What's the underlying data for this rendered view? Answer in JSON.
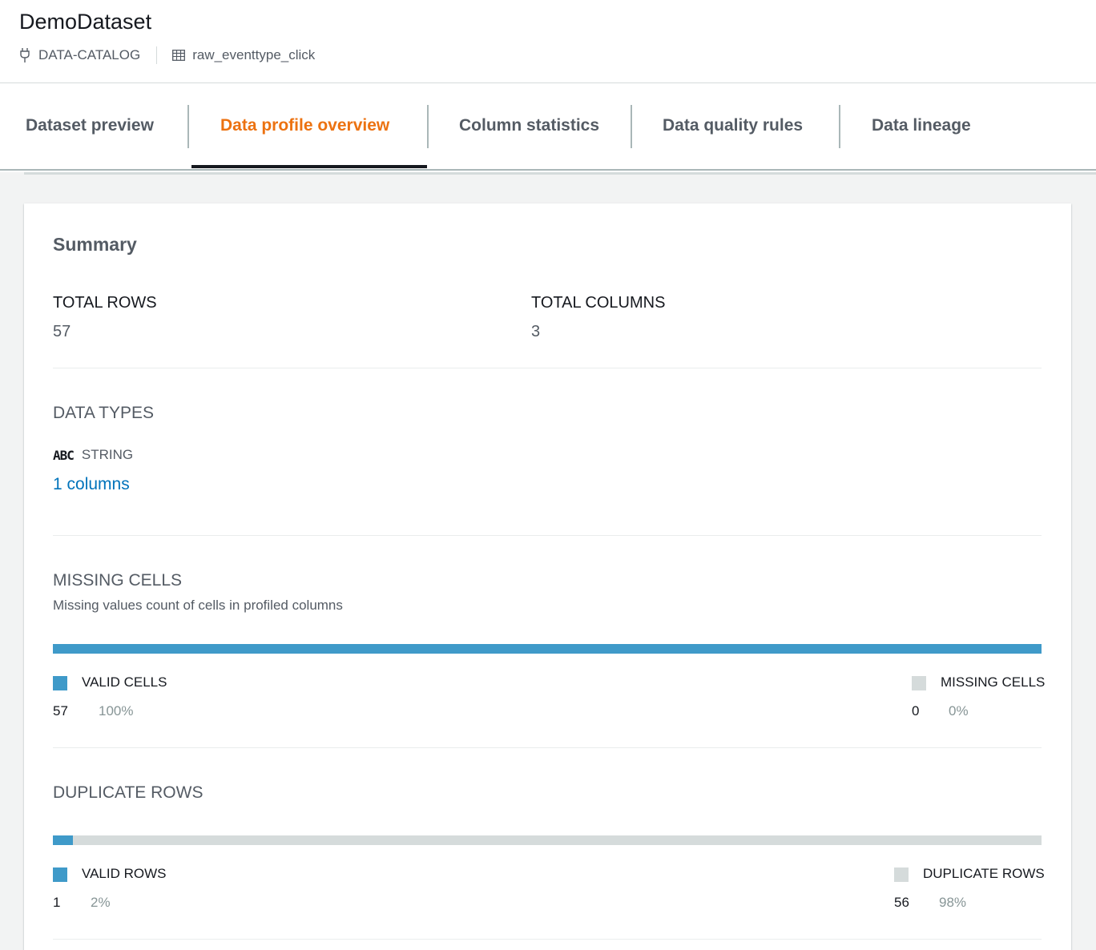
{
  "header": {
    "title": "DemoDataset",
    "source": "DATA-CATALOG",
    "table": "raw_eventtype_click"
  },
  "tabs": [
    {
      "label": "Dataset preview",
      "active": false
    },
    {
      "label": "Data profile overview",
      "active": true
    },
    {
      "label": "Column statistics",
      "active": false
    },
    {
      "label": "Data quality rules",
      "active": false
    },
    {
      "label": "Data lineage",
      "active": false
    }
  ],
  "summary": {
    "title": "Summary",
    "total_rows_label": "TOTAL ROWS",
    "total_rows": "57",
    "total_columns_label": "TOTAL COLUMNS",
    "total_columns": "3"
  },
  "data_types": {
    "title": "DATA TYPES",
    "type_icon": "ABC",
    "type_label": "STRING",
    "columns_link": "1 columns"
  },
  "missing_cells": {
    "title": "MISSING CELLS",
    "description": "Missing values count of cells in profiled columns",
    "valid_fraction": 1.0,
    "valid_label": "VALID CELLS",
    "valid_count": "57",
    "valid_pct": "100%",
    "missing_label": "MISSING CELLS",
    "missing_count": "0",
    "missing_pct": "0%"
  },
  "duplicate_rows": {
    "title": "DUPLICATE ROWS",
    "valid_fraction": 0.02,
    "valid_label": "VALID ROWS",
    "valid_count": "1",
    "valid_pct": "2%",
    "duplicate_label": "DUPLICATE ROWS",
    "duplicate_count": "56",
    "duplicate_pct": "98%"
  },
  "colors": {
    "accent_tab": "#ec7211",
    "bar_valid": "#3f9ac9",
    "bar_other": "#d5dbdb",
    "link": "#0073bb"
  },
  "icons": {
    "source": "plug-icon",
    "table": "table-icon",
    "type": "abc-string-icon"
  }
}
